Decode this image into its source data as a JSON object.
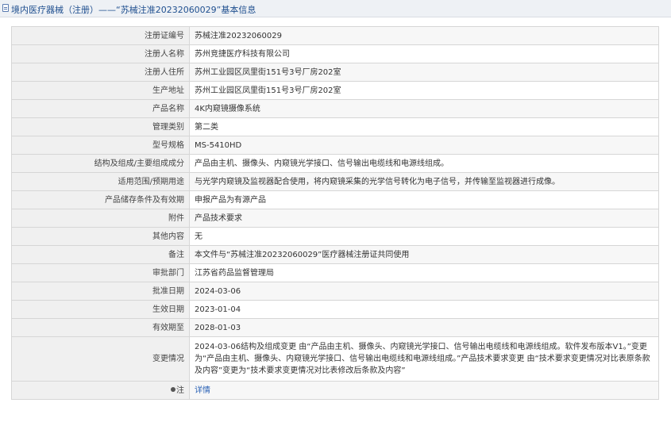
{
  "header": {
    "title": "境内医疗器械（注册）——“苏械注准20232060029”基本信息"
  },
  "rows": [
    {
      "label": "注册证编号",
      "value": "苏械注准20232060029"
    },
    {
      "label": "注册人名称",
      "value": "苏州竞捷医疗科技有限公司"
    },
    {
      "label": "注册人住所",
      "value": "苏州工业园区凤里街151号3号厂房202室"
    },
    {
      "label": "生产地址",
      "value": "苏州工业园区凤里街151号3号厂房202室"
    },
    {
      "label": "产品名称",
      "value": "4K内窥镜摄像系统"
    },
    {
      "label": "管理类别",
      "value": "第二类"
    },
    {
      "label": "型号规格",
      "value": "MS-5410HD"
    },
    {
      "label": "结构及组成/主要组成成分",
      "value": "产品由主机、摄像头、内窥镜光学接口、信号输出电缆线和电源线组成。"
    },
    {
      "label": "适用范围/预期用途",
      "value": "与光学内窥镜及监视器配合使用，将内窥镜采集的光学信号转化为电子信号，并传输至监视器进行成像。"
    },
    {
      "label": "产品储存条件及有效期",
      "value": "申报产品为有源产品"
    },
    {
      "label": "附件",
      "value": "产品技术要求"
    },
    {
      "label": "其他内容",
      "value": "无"
    },
    {
      "label": "备注",
      "value": "本文件与“苏械注准20232060029”医疗器械注册证共同使用"
    },
    {
      "label": "审批部门",
      "value": "江苏省药品监督管理局"
    },
    {
      "label": "批准日期",
      "value": "2024-03-06"
    },
    {
      "label": "生效日期",
      "value": "2023-01-04"
    },
    {
      "label": "有效期至",
      "value": "2028-01-03"
    },
    {
      "label": "变更情况",
      "value": "2024-03-06结构及组成变更 由“产品由主机、摄像头、内窥镜光学接口、信号输出电缆线和电源线组成。软件发布版本V1。”变更为“产品由主机、摄像头、内窥镜光学接口、信号输出电缆线和电源线组成。”产品技术要求变更 由“技术要求变更情况对比表原条款及内容”变更为“技术要求变更情况对比表修改后条款及内容”"
    }
  ],
  "note": {
    "label": "注",
    "link_text": "详情"
  }
}
